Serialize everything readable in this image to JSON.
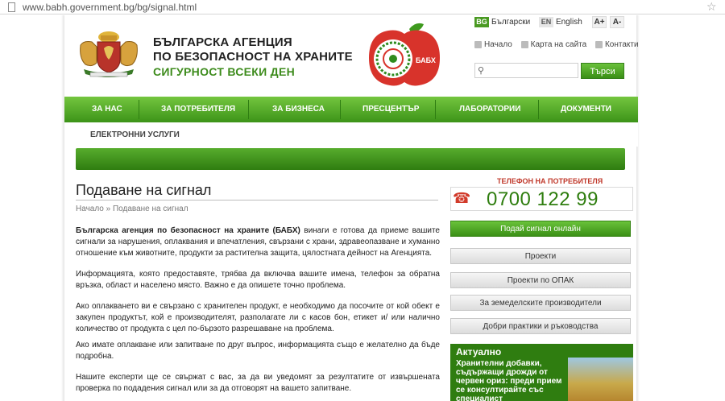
{
  "browser": {
    "url": "www.babh.government.bg/bg/signal.html"
  },
  "header": {
    "title_line1": "БЪЛГАРСКА АГЕНЦИЯ",
    "title_line2": "ПО БЕЗОПАСНОСТ НА ХРАНИТЕ",
    "slogan": "СИГУРНОСТ ВСЕКИ ДЕН",
    "logo_text": "БАБХ"
  },
  "languages": {
    "bg_code": "BG",
    "bg_label": "Български",
    "en_code": "EN",
    "en_label": "English",
    "font_increase": "A+",
    "font_decrease": "A-"
  },
  "top_links": {
    "home": "Начало",
    "sitemap": "Карта на сайта",
    "contacts": "Контакти"
  },
  "search": {
    "placeholder": "",
    "button": "Търси"
  },
  "nav": {
    "items": [
      "ЗА НАС",
      "ЗА ПОТРЕБИТЕЛЯ",
      "ЗА БИЗНЕСА",
      "ПРЕСЦЕНТЪР",
      "ЛАБОРАТОРИИ",
      "ДОКУМЕНТИ"
    ],
    "second_row": "ЕЛЕКТРОННИ УСЛУГИ"
  },
  "main": {
    "title": "Подаване на сигнал",
    "breadcrumb": "Начало » Подаване на сигнал",
    "p1_bold": "Българска агенция по безопасност на храните (БАБХ)",
    "p1_rest": " винаги е готова да приеме вашите сигнали за нарушения, оплаквания и впечатления, свързани с  храни, здравеопазване и хуманно отношение към животните, продукти за растителна защита, цялостната дейност на Агенцията.",
    "p2": "Информацията, която предоставяте, трябва да включва вашите имена, телефон за обратна връзка, област и населено място. Важно е да опишете точно проблема.",
    "p3": "Ако  оплакването ви е свързано с хранителен продукт, е необходимо да посочите от кой обект е закупен продуктът, кой е производителят, разполагате ли с касов бон, етикет и/ или налично количество от продукта с цел по-бързото разрешаване на проблема.",
    "p4": "Ако имате оплакване или запитване по друг въпрос, информацията също е желателно да бъде подробна.",
    "p5": "Нашите експерти ще се свържат с вас, за да ви уведомят за резултатите от извършената проверка по подадения сигнал или за да отговорят на вашето запитване."
  },
  "sidebar": {
    "phone_label": "ТЕЛЕФОН НА ПОТРЕБИТЕЛЯ",
    "phone_number": "0700 122 99",
    "buttons": [
      "Подай сигнал онлайн",
      "Проекти",
      "Проекти по ОПАК",
      "За земеделските производители",
      "Добри практики и ръководства"
    ],
    "news_heading": "Актуално",
    "news_text": "Хранителни добавки, съдържащи дрожди от червен ориз: преди прием се консултирайте със специалист"
  },
  "colors": {
    "green": "#3c9318",
    "dark_green": "#2f7d10",
    "red": "#d13a2a"
  }
}
